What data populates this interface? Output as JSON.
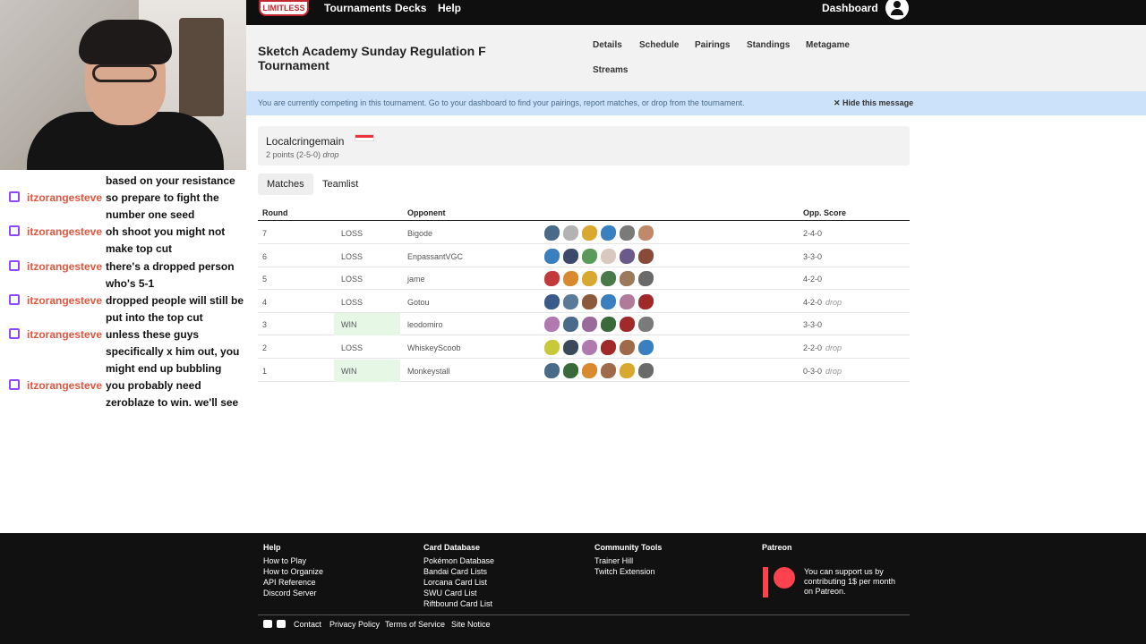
{
  "chat": [
    {
      "user": "",
      "message": "based on your resistance"
    },
    {
      "user": "itzorangesteve",
      "message": "so prepare to fight the number one seed"
    },
    {
      "user": "itzorangesteve",
      "message": "oh shoot you might not make top cut"
    },
    {
      "user": "itzorangesteve",
      "message": "there's a dropped person who's 5-1"
    },
    {
      "user": "itzorangesteve",
      "message": "dropped people will still be put into the top cut"
    },
    {
      "user": "itzorangesteve",
      "message": "unless these guys specifically x him out, you might end up bubbling"
    },
    {
      "user": "itzorangesteve",
      "message": "you probably need zeroblaze to win. we'll see"
    }
  ],
  "nav": {
    "tournaments": "Tournaments",
    "decks": "Decks",
    "help": "Help",
    "dashboard": "Dashboard"
  },
  "tournament": {
    "title": "Sketch Academy Sunday Regulation F Tournament",
    "tabs": [
      "Details",
      "Schedule",
      "Pairings",
      "Standings",
      "Metagame",
      "Streams"
    ]
  },
  "alert": {
    "text": "You are currently competing in this tournament. Go to your dashboard to find your pairings, report matches, or drop from the tournament.",
    "hide": "Hide this message"
  },
  "player": {
    "name": "Localcringemain",
    "points": "2 points (2-5-0)",
    "status": "drop"
  },
  "subtabs": [
    "Matches",
    "Teamlist"
  ],
  "table": {
    "headers": {
      "round": "Round",
      "opponent": "Opponent",
      "score": "Opp. Score"
    },
    "rows": [
      {
        "round": "7",
        "result": "LOSS",
        "opponent": "Bigode",
        "score": "2-4-0",
        "drop": ""
      },
      {
        "round": "6",
        "result": "LOSS",
        "opponent": "EnpassantVGC",
        "score": "3-3-0",
        "drop": ""
      },
      {
        "round": "5",
        "result": "LOSS",
        "opponent": "jame",
        "score": "4-2-0",
        "drop": ""
      },
      {
        "round": "4",
        "result": "LOSS",
        "opponent": "Gotou",
        "score": "4-2-0",
        "drop": "drop"
      },
      {
        "round": "3",
        "result": "WIN",
        "opponent": "leodomiro",
        "score": "3-3-0",
        "drop": ""
      },
      {
        "round": "2",
        "result": "LOSS",
        "opponent": "WhiskeyScoob",
        "score": "2-2-0",
        "drop": "drop"
      },
      {
        "round": "1",
        "result": "WIN",
        "opponent": "Monkeystall",
        "score": "0-3-0",
        "drop": "drop"
      }
    ]
  },
  "team_colors": [
    [
      "#4a6a8a",
      "#b3b3b3",
      "#d9a82e",
      "#3a7fbf",
      "#7a7a7a",
      "#c08a6a"
    ],
    [
      "#3a7fbf",
      "#3b4a6b",
      "#5a9a5a",
      "#d8c8c0",
      "#6a5a8a",
      "#8a4a3a"
    ],
    [
      "#c23a3a",
      "#d98a2e",
      "#d9a82e",
      "#4a7a4a",
      "#9a7a5a",
      "#6a6a6a"
    ],
    [
      "#3a5a8a",
      "#5a7a9a",
      "#8a5a3a",
      "#3a7fbf",
      "#b07a9a",
      "#a02a2a"
    ],
    [
      "#b07ab0",
      "#4a6a8a",
      "#9a6a9a",
      "#3a6a3a",
      "#a02a2a",
      "#7a7a7a"
    ],
    [
      "#c8c83a",
      "#3a4a5a",
      "#b07ab0",
      "#a02a2a",
      "#a06a4a",
      "#3a7fbf"
    ],
    [
      "#4a6a8a",
      "#3a6a3a",
      "#d98a2e",
      "#a06a4a",
      "#d9a82e",
      "#6a6a6a"
    ]
  ],
  "footer": {
    "help": {
      "title": "Help",
      "links": [
        "How to Play",
        "How to Organize",
        "API Reference",
        "Discord Server"
      ]
    },
    "cards": {
      "title": "Card Database",
      "links": [
        "Pokémon Database",
        "Bandai Card Lists",
        "Lorcana Card List",
        "SWU Card List",
        "Riftbound Card List"
      ]
    },
    "community": {
      "title": "Community Tools",
      "links": [
        "Trainer Hill",
        "Twitch Extension"
      ]
    },
    "patreon": {
      "title": "Patreon",
      "text": "You can support us by contributing 1$ per month on Patreon."
    },
    "bottom": [
      "Contact",
      "Privacy Policy",
      "Terms of Service",
      "Site Notice"
    ]
  }
}
